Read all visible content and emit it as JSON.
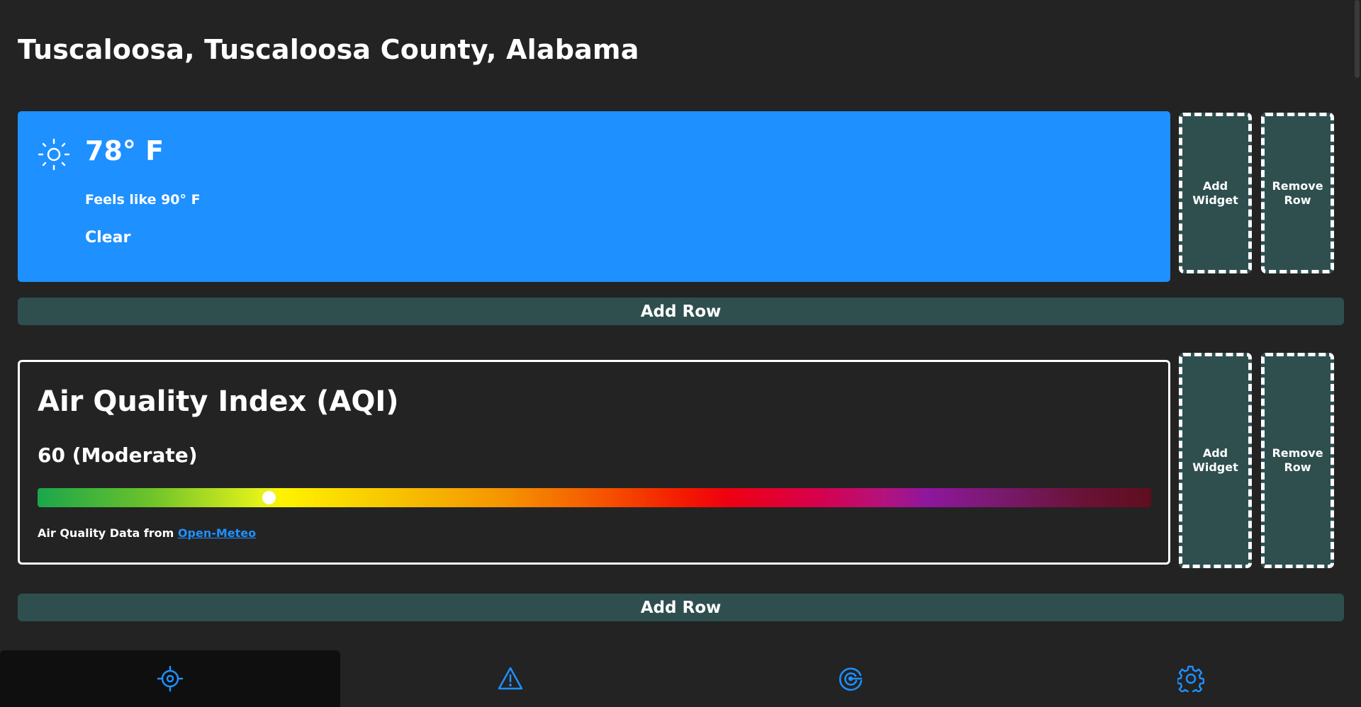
{
  "location": {
    "title": "Tuscaloosa, Tuscaloosa County, Alabama"
  },
  "weather": {
    "temperature": "78° F",
    "feels_like": "Feels like 90° F",
    "condition": "Clear",
    "icon": "sun-icon",
    "card_color": "#1e90ff"
  },
  "aqi": {
    "title": "Air Quality Index (AQI)",
    "value_text": "60 (Moderate)",
    "value": 60,
    "scale_max": 289,
    "source_prefix": "Air Quality Data from",
    "source_link": "Open-Meteo"
  },
  "row_controls": {
    "add_widget_line1": "Add",
    "add_widget_line2": "Widget",
    "remove_row_line1": "Remove",
    "remove_row_line2": "Row",
    "add_row": "Add Row",
    "button_color": "#2f4f4f"
  },
  "nav": {
    "items": [
      {
        "icon": "location-target-icon",
        "active": true
      },
      {
        "icon": "warning-icon",
        "active": false
      },
      {
        "icon": "radar-icon",
        "active": false
      },
      {
        "icon": "gear-icon",
        "active": false
      }
    ],
    "icon_color": "#1e90ff"
  }
}
